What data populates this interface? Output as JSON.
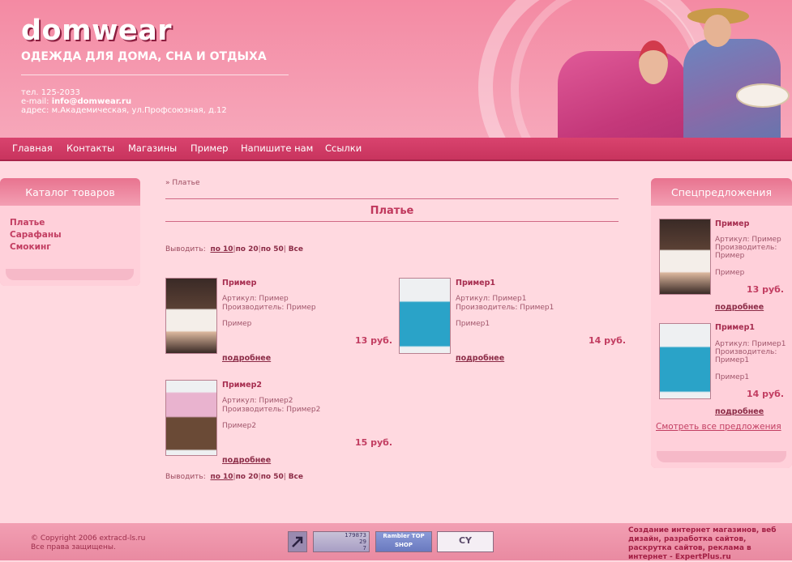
{
  "header": {
    "logo": "domwear",
    "tagline": "ОДЕЖДА ДЛЯ ДОМА, СНА И ОТДЫХА",
    "phone": "тел. 125-2033",
    "email_label": "e-mail: ",
    "email": "info@domwear.ru",
    "address": "адрес: м.Академическая, ул.Профсоюзная, д.12"
  },
  "nav": [
    "Главная",
    "Контакты",
    "Магазины",
    "Пример",
    "Напишите нам",
    "Ссылки"
  ],
  "catalog": {
    "title": "Каталог товаров",
    "items": [
      "Платье",
      "Сарафаны",
      "Смокинг"
    ]
  },
  "main": {
    "breadcrumb": "» Платье",
    "title": "Платье",
    "pager": {
      "label": "Выводить:",
      "options": [
        "по 10",
        "по 20",
        "по 50",
        "Все"
      ],
      "sep": "|"
    },
    "products": [
      {
        "name": "Пример",
        "article": "Артикул: Пример",
        "maker": "Производитель: Пример",
        "desc": "Пример",
        "price": "13 руб.",
        "more": "подробнее"
      },
      {
        "name": "Пример1",
        "article": "Артикул: Пример1",
        "maker": "Производитель: Пример1",
        "desc": "Пример1",
        "price": "14 руб.",
        "more": "подробнее"
      },
      {
        "name": "Пример2",
        "article": "Артикул: Пример2",
        "maker": "Производитель: Пример2",
        "desc": "Пример2",
        "price": "15 руб.",
        "more": "подробнее"
      }
    ]
  },
  "specials": {
    "title": "Спецпредложения",
    "items": [
      {
        "name": "Пример",
        "article": "Артикул: Пример",
        "maker1": "Производитель:",
        "maker2": "Пример",
        "desc": "Пример",
        "price": "13 руб.",
        "more": "подробнее"
      },
      {
        "name": "Пример1",
        "article": "Артикул: Пример1",
        "maker1": "Производитель:",
        "maker2": "Пример1",
        "desc": "Пример1",
        "price": "14 руб.",
        "more": "подробнее"
      }
    ],
    "all_link": "Смотреть все предложения"
  },
  "footer": {
    "copyright": "© Copyright 2006 extracd-ls.ru",
    "rights": "Все права защищены.",
    "credits": "Создание интернет магазинов, веб дизайн, разработка сайтов, раскрутка сайтов, реклама в интернет - ExpertPlus.ru",
    "counter1": "179873",
    "counter2": "29",
    "counter3": "7",
    "badge_rambler": "Rambler TOP SHOP",
    "badge_cy": "CY"
  },
  "colors": {
    "accent": "#c23d61",
    "nav": "#d9436e",
    "background": "#ffd9e0"
  }
}
